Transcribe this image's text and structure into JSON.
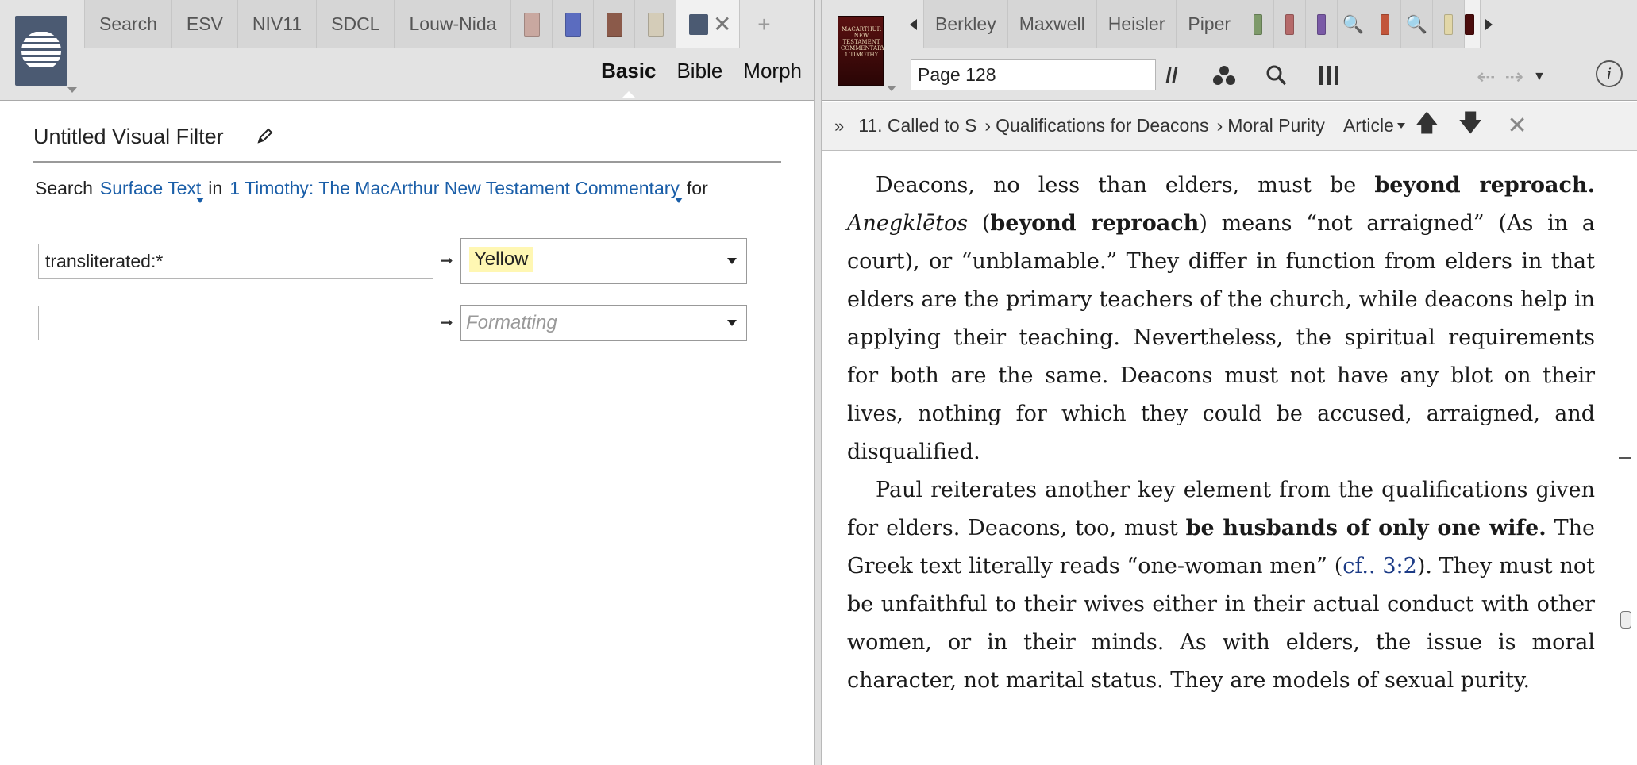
{
  "left": {
    "tabs": [
      "Search",
      "ESV",
      "NIV11",
      "SDCL",
      "Louw-Nida"
    ],
    "book_tab_colors": [
      "#c9a8a0",
      "#5b6cbf",
      "#8b5a4a",
      "#d4ccb8"
    ],
    "active_tab_close": "✕",
    "add_tab": "+",
    "modes": [
      "Basic",
      "Bible",
      "Morph"
    ],
    "filter_title": "Untitled Visual Filter",
    "search_row": {
      "search_label": "Search",
      "field": "Surface Text",
      "in_label": "in",
      "resource": "1 Timothy: The MacArthur New Testament Commentary",
      "for_label": "for"
    },
    "rules": [
      {
        "query": "transliterated:*",
        "format": "Yellow"
      },
      {
        "query": "",
        "format_placeholder": "Formatting"
      }
    ]
  },
  "right": {
    "cover_text": "MACARTHUR NEW TESTAMENT COMMENTARY 1 TIMOTHY",
    "tabs": [
      "Berkley",
      "Maxwell",
      "Heisler",
      "Piper"
    ],
    "page_field": "Page 128",
    "breadcrumb": {
      "expand": "»",
      "items": [
        "11. Called to S",
        "Qualifications for Deacons",
        "Moral Purity"
      ],
      "article": "Article"
    },
    "paragraphs": [
      {
        "segments": [
          {
            "t": "Deacons, no less than elders, must be ",
            "s": "normal"
          },
          {
            "t": "beyond reproach.",
            "s": "bold"
          },
          {
            "t": " ",
            "s": "normal"
          },
          {
            "t": "Anegklētos",
            "s": "italic"
          },
          {
            "t": " (",
            "s": "normal"
          },
          {
            "t": "beyond reproach",
            "s": "bold"
          },
          {
            "t": ") means “not arraigned” (As in a court), or “unblamable.” They differ in function from elders in that elders are the primary teachers of the church, while deacons help in applying their teaching. Nevertheless, the spiritual require­ments for both are the same. Deacons must not have any blot on their lives, nothing for which they could be accused, arraigned, and disqualified.",
            "s": "normal"
          }
        ]
      },
      {
        "segments": [
          {
            "t": "Paul reiterates another key element from the qualifications given for elders. Deacons, too, must ",
            "s": "normal"
          },
          {
            "t": "be husbands of only one wife.",
            "s": "bold"
          },
          {
            "t": " The Greek text literally reads “one-woman men” (",
            "s": "normal"
          },
          {
            "t": "cf.. 3:2",
            "s": "ref"
          },
          {
            "t": "). They must not be unfaithful to their wives either in their actual conduct with other women, or in their minds. As with elders, the issue is moral character, not marital status. They are models of sexual purity.",
            "s": "normal"
          }
        ]
      }
    ]
  }
}
